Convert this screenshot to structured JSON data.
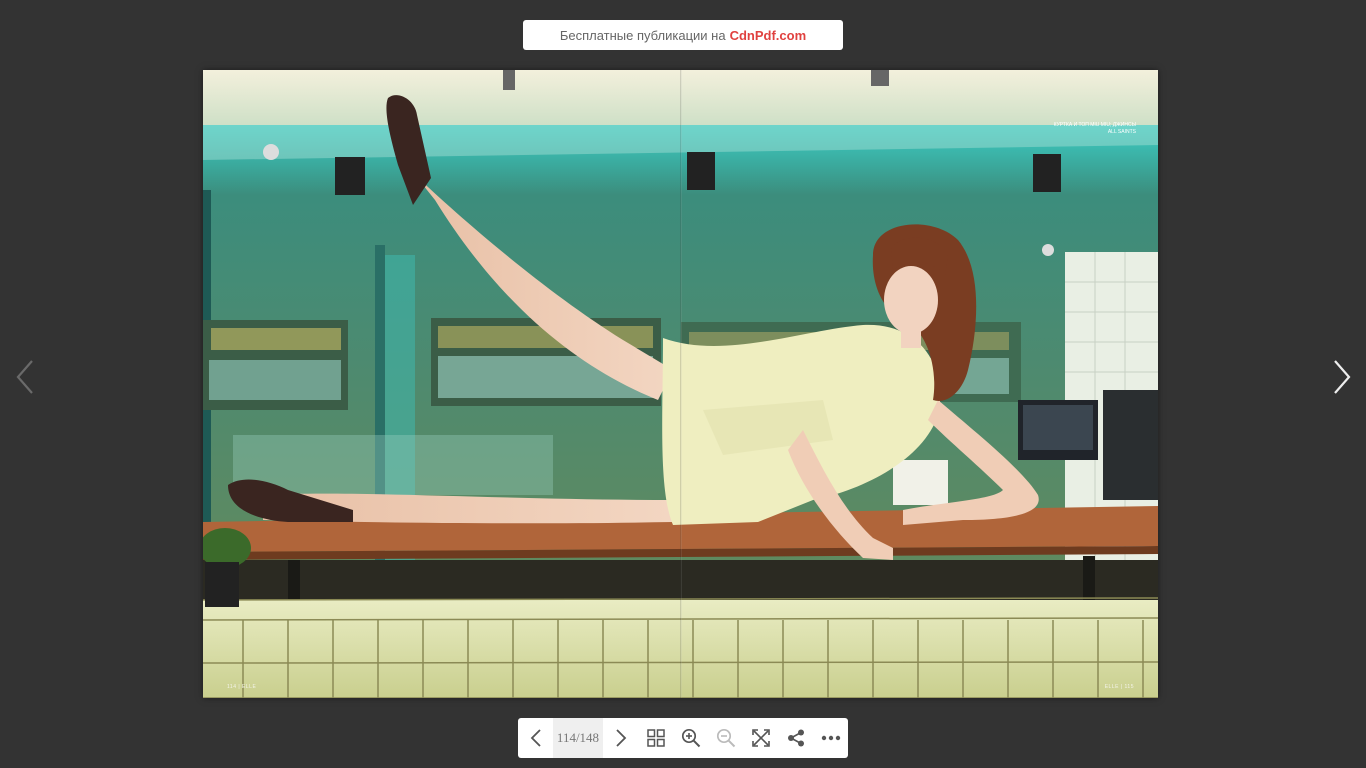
{
  "banner": {
    "prefix": "Бесплатные публикации на",
    "brand": "CdnPdf.com"
  },
  "spread": {
    "caption": "КУРТКА И ТОП MIU MIU; ДЖИНСЫ ALL SAINTS",
    "folio_left": "114 | ELLE",
    "folio_right": "ELLE | 115"
  },
  "toolbar": {
    "page_indicator": "114/148"
  },
  "colors": {
    "background": "#333333",
    "brand": "#e0413f",
    "icon": "#555555"
  },
  "icons": {
    "prev": "chevron-left-icon",
    "next": "chevron-right-icon",
    "thumbnails": "grid-icon",
    "zoom_in": "zoom-in-icon",
    "zoom_out": "zoom-out-icon",
    "fullscreen": "fullscreen-icon",
    "share": "share-icon",
    "more": "more-icon"
  }
}
